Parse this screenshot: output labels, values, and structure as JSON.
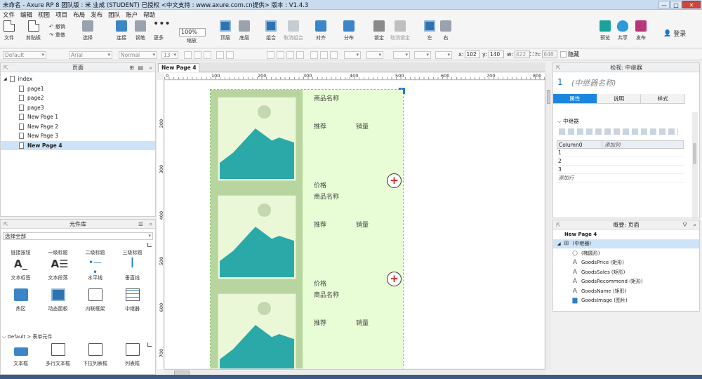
{
  "window": {
    "title": "未命名 - Axure RP 8 团队版 : 米 业成 (STUDENT) 已授权     <中文支持 : www.axure.com.cn提供> 版本 : V1.4.3",
    "minimize": "—",
    "maximize": "□",
    "close": "✕"
  },
  "menu": [
    "文件",
    "编辑",
    "视图",
    "项目",
    "布局",
    "发布",
    "团队",
    "账户",
    "帮助"
  ],
  "toolbar": {
    "file": "文件",
    "clipboard": "剪贴板",
    "undo": "撤销",
    "redo": "重做",
    "select": "选择",
    "connect": "连接",
    "pen": "钢笔",
    "more": "更多",
    "zoom_value": "100%",
    "zoom": "缩放",
    "top": "顶层",
    "bottom": "底层",
    "group": "组合",
    "ungroup": "取消组合",
    "align": "对齐",
    "distribute": "分布",
    "lock": "锁定",
    "unlock": "取消锁定",
    "left": "左",
    "right": "右",
    "preview": "预览",
    "share": "共享",
    "publish": "发布",
    "login": "登录"
  },
  "format": {
    "style": "Default",
    "font": "Arial",
    "weight": "Normal",
    "size": "13",
    "x_label": "x:",
    "x": "102",
    "y_label": "y:",
    "y": "140",
    "w_label": "w:",
    "w": "422",
    "h_label": "h:",
    "h": "648",
    "hidden": "隐藏"
  },
  "pages_panel": {
    "title": "页面",
    "root": "index",
    "pages": [
      "page1",
      "page2",
      "page3",
      "New Page 1",
      "New Page 2",
      "New Page 3",
      "New Page 4"
    ],
    "selected": "New Page 4"
  },
  "library_panel": {
    "title": "元件库",
    "filter": "选择全部",
    "row1": [
      "链接按钮",
      "一级标题",
      "二级标题",
      "三级标题"
    ],
    "row2": [
      "文本标签",
      "文本段落",
      "水平线",
      "垂直线"
    ],
    "row3": [
      "热区",
      "动态面板",
      "内联框架",
      "中继器"
    ],
    "section": "Default > 表单元件",
    "row4": [
      "文本框",
      "多行文本框",
      "下拉列表框",
      "列表框"
    ]
  },
  "canvas": {
    "tab": "New Page 4",
    "tab_close": "✕",
    "ruler_h": [
      "0",
      "100",
      "200",
      "300",
      "400",
      "500",
      "600",
      "700",
      "800"
    ],
    "ruler_v": [
      "200",
      "300",
      "400",
      "500",
      "600",
      "700"
    ],
    "badge": "1",
    "items": [
      {
        "name": "商品名称",
        "recommend": "推荐",
        "sales": "销量",
        "price": "价格",
        "plus": "+"
      },
      {
        "name": "商品名称",
        "recommend": "推荐",
        "sales": "销量",
        "price": "价格",
        "plus": "+"
      },
      {
        "name": "商品名称",
        "recommend": "推荐",
        "sales": "销量"
      }
    ]
  },
  "inspector": {
    "title": "检视: 中继器",
    "number": "1",
    "name_placeholder": "(中继器名称)",
    "tabs": [
      "属性",
      "说明",
      "样式"
    ],
    "section": "中继器",
    "col_header": "Column0",
    "add_col": "添加列",
    "rows": [
      "1",
      "2",
      "3"
    ],
    "add_row": "添加行"
  },
  "outline": {
    "title": "概要: 页面",
    "page": "New Page 4",
    "repeater": "(中继器)",
    "children": [
      {
        "icon": "○",
        "label": "(椭圆形)"
      },
      {
        "icon": "A",
        "label": "GoodsPrice (矩形)"
      },
      {
        "icon": "A",
        "label": "GoodsSales (矩形)"
      },
      {
        "icon": "A",
        "label": "GoodsRecommend (矩形)"
      },
      {
        "icon": "A",
        "label": "GoodsName (矩形)"
      },
      {
        "icon": "▆",
        "label": "GoodsImage (图片)"
      }
    ]
  }
}
